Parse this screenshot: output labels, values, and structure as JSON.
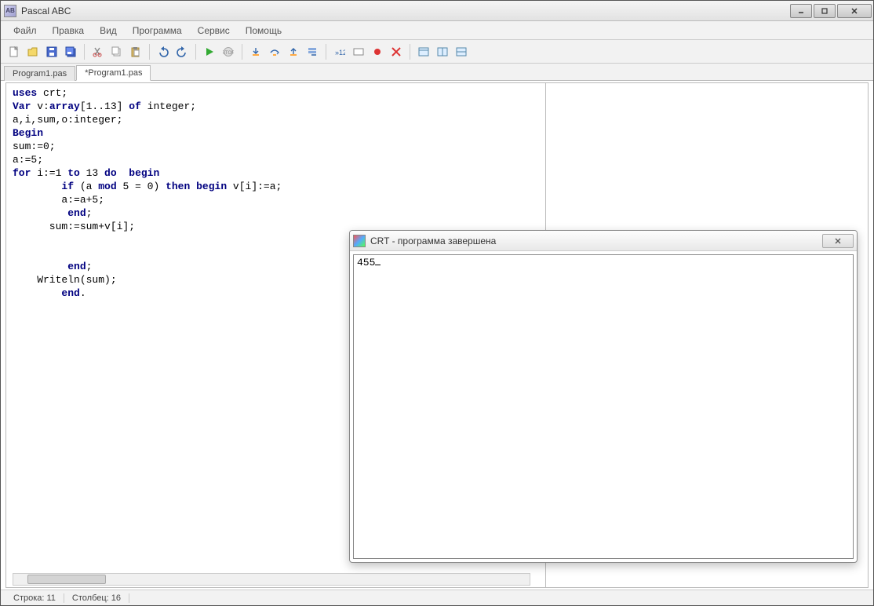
{
  "window": {
    "title": "Pascal ABC",
    "app_icon_text": "AB"
  },
  "menu": {
    "items": [
      "Файл",
      "Правка",
      "Вид",
      "Программа",
      "Сервис",
      "Помощь"
    ]
  },
  "toolbar_icons": [
    "new-file-icon",
    "open-icon",
    "save-icon",
    "save-all-icon",
    "cut-icon",
    "copy-icon",
    "paste-icon",
    "undo-icon",
    "redo-icon",
    "run-icon",
    "stop-icon",
    "step-into-icon",
    "step-over-icon",
    "step-out-icon",
    "run-to-cursor-icon",
    "trace-icon",
    "watch-icon",
    "breakpoint-icon",
    "clear-breakpoints-icon",
    "window1-icon",
    "window2-icon",
    "window3-icon"
  ],
  "tabs": [
    {
      "label": "Program1.pas",
      "active": false
    },
    {
      "label": "*Program1.pas",
      "active": true
    }
  ],
  "code_lines": [
    {
      "t": "kw",
      "x": "uses"
    },
    {
      "t": "pl",
      "x": " crt;"
    },
    {
      "nl": true
    },
    {
      "t": "kw",
      "x": "Var"
    },
    {
      "t": "pl",
      "x": " v:"
    },
    {
      "t": "kw",
      "x": "array"
    },
    {
      "t": "pl",
      "x": "[1..13] "
    },
    {
      "t": "kw",
      "x": "of"
    },
    {
      "t": "pl",
      "x": " integer;"
    },
    {
      "nl": true
    },
    {
      "t": "pl",
      "x": "a,i,sum,o:integer;"
    },
    {
      "nl": true
    },
    {
      "t": "kw",
      "x": "Begin"
    },
    {
      "nl": true
    },
    {
      "t": "pl",
      "x": "sum:=0;"
    },
    {
      "nl": true
    },
    {
      "t": "pl",
      "x": "a:=5;"
    },
    {
      "nl": true
    },
    {
      "t": "kw",
      "x": "for"
    },
    {
      "t": "pl",
      "x": " i:=1 "
    },
    {
      "t": "kw",
      "x": "to"
    },
    {
      "t": "pl",
      "x": " 13 "
    },
    {
      "t": "kw",
      "x": "do"
    },
    {
      "t": "pl",
      "x": "  "
    },
    {
      "t": "kw",
      "x": "begin"
    },
    {
      "nl": true
    },
    {
      "t": "pl",
      "x": "        "
    },
    {
      "t": "kw",
      "x": "if"
    },
    {
      "t": "pl",
      "x": " (a "
    },
    {
      "t": "kw",
      "x": "mod"
    },
    {
      "t": "pl",
      "x": " 5 = 0) "
    },
    {
      "t": "kw",
      "x": "then"
    },
    {
      "t": "pl",
      "x": " "
    },
    {
      "t": "kw",
      "x": "begin"
    },
    {
      "t": "pl",
      "x": " v[i]:=a;"
    },
    {
      "nl": true
    },
    {
      "t": "pl",
      "x": "        a:=a+5;"
    },
    {
      "nl": true
    },
    {
      "t": "pl",
      "x": "         "
    },
    {
      "t": "kw",
      "x": "end"
    },
    {
      "t": "pl",
      "x": ";"
    },
    {
      "nl": true
    },
    {
      "t": "pl",
      "x": "      sum:=sum+v[i];"
    },
    {
      "nl": true
    },
    {
      "t": "pl",
      "x": ""
    },
    {
      "nl": true
    },
    {
      "t": "pl",
      "x": ""
    },
    {
      "nl": true
    },
    {
      "t": "pl",
      "x": "         "
    },
    {
      "t": "kw",
      "x": "end"
    },
    {
      "t": "pl",
      "x": ";"
    },
    {
      "nl": true
    },
    {
      "t": "pl",
      "x": "    Writeln(sum);"
    },
    {
      "nl": true
    },
    {
      "t": "pl",
      "x": "        "
    },
    {
      "t": "kw",
      "x": "end"
    },
    {
      "t": "pl",
      "x": "."
    }
  ],
  "crt": {
    "title": "CRT - программа завершена",
    "output": "455"
  },
  "status": {
    "line_label": "Строка: 11",
    "col_label": "Столбец: 16"
  }
}
